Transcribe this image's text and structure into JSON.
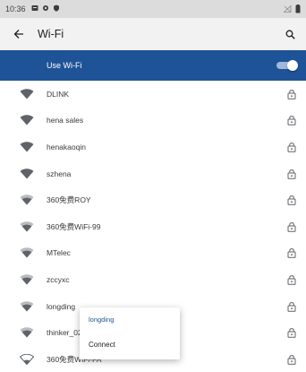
{
  "status_bar": {
    "time": "10:36"
  },
  "app_bar": {
    "title": "Wi-Fi"
  },
  "master_switch": {
    "label": "Use Wi-Fi",
    "enabled": true
  },
  "networks": [
    {
      "ssid": "DLINK",
      "secured": true,
      "signal": "strong"
    },
    {
      "ssid": "hena sales",
      "secured": true,
      "signal": "strong"
    },
    {
      "ssid": "henakaoqin",
      "secured": true,
      "signal": "strong"
    },
    {
      "ssid": "szhena",
      "secured": true,
      "signal": "strong"
    },
    {
      "ssid": "360免费ROY",
      "secured": true,
      "signal": "medium"
    },
    {
      "ssid": "360免费WiFi-99",
      "secured": true,
      "signal": "medium"
    },
    {
      "ssid": "MTelec",
      "secured": true,
      "signal": "medium"
    },
    {
      "ssid": "zccyxc",
      "secured": true,
      "signal": "medium"
    },
    {
      "ssid": "longding",
      "secured": true,
      "signal": "medium"
    },
    {
      "ssid": "thinker_02",
      "secured": true,
      "signal": "medium"
    },
    {
      "ssid": "360免费WiFi-FA",
      "secured": true,
      "signal": "weak"
    }
  ],
  "popup": {
    "title": "longding",
    "action": "Connect"
  },
  "colors": {
    "accent": "#1f5397",
    "status_bar": "#dcdcdc",
    "app_bar": "#f2f2f2",
    "icon": "#5f6368"
  }
}
